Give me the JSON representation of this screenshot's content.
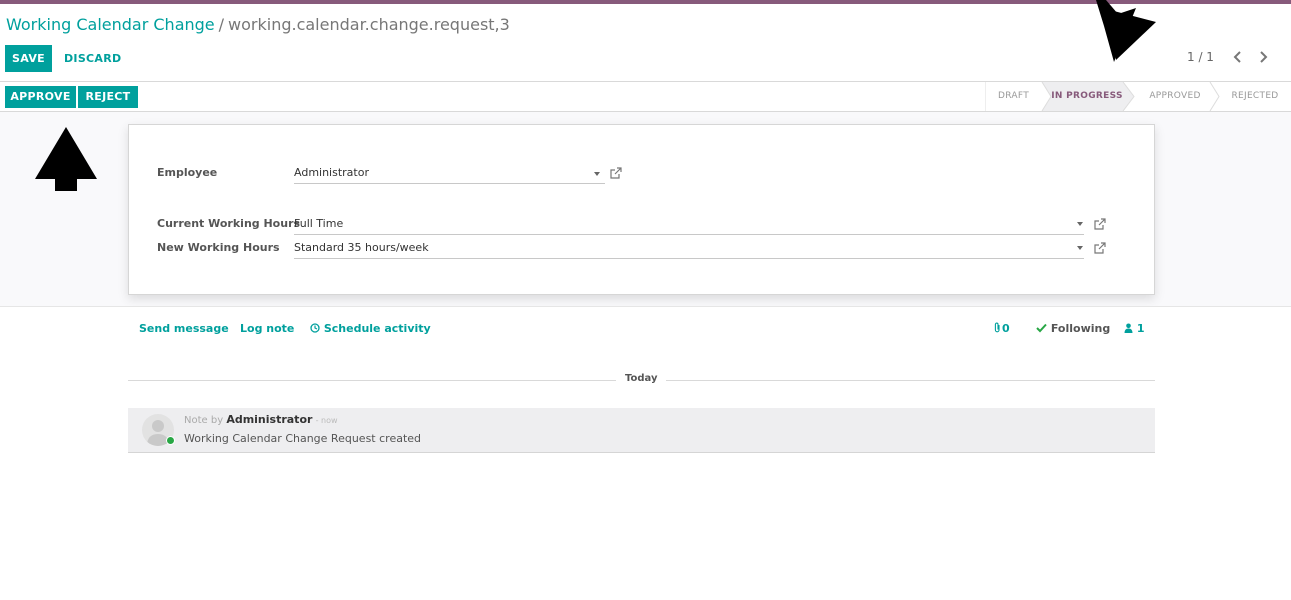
{
  "breadcrumb": {
    "parent": "Working Calendar Change",
    "separator": "/",
    "current": "working.calendar.change.request,3"
  },
  "toolbar": {
    "save_label": "SAVE",
    "discard_label": "DISCARD"
  },
  "pager": {
    "value": "1 / 1"
  },
  "actions": {
    "approve_label": "APPROVE",
    "reject_label": "REJECT"
  },
  "stages": [
    {
      "label": "DRAFT",
      "active": false
    },
    {
      "label": "IN PROGRESS",
      "active": true
    },
    {
      "label": "APPROVED",
      "active": false
    },
    {
      "label": "REJECTED",
      "active": false
    }
  ],
  "form": {
    "employee_label": "Employee",
    "employee_value": "Administrator",
    "current_hours_label": "Current Working Hours",
    "current_hours_value": "Full Time",
    "new_hours_label": "New Working Hours",
    "new_hours_value": "Standard 35 hours/week"
  },
  "chatter": {
    "send_message": "Send message",
    "log_note": "Log note",
    "schedule_activity": "Schedule activity",
    "attachments_count": "0",
    "following": "Following",
    "followers_count": "1",
    "date_separator": "Today",
    "message": {
      "prefix": "Note by",
      "author": "Administrator",
      "time": "- now",
      "body": "Working Calendar Change Request created"
    }
  },
  "colors": {
    "primary": "#00a09d",
    "brand": "#875a7b",
    "online": "#28a745"
  }
}
